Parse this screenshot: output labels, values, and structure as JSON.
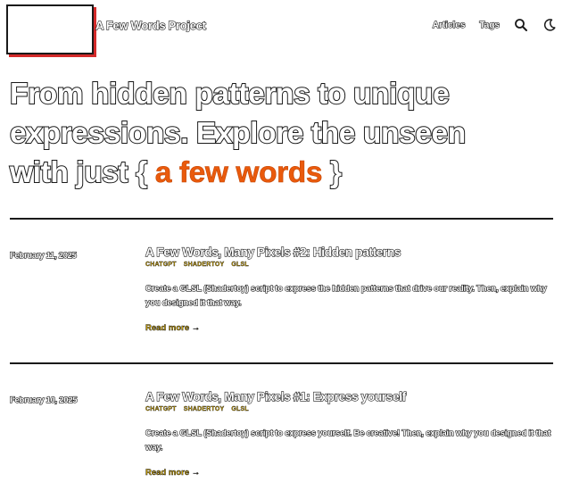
{
  "header": {
    "site_title": "A Few Words Project",
    "nav": {
      "articles": "Articles",
      "tags": "Tags"
    },
    "icons": {
      "search": "search-icon",
      "theme": "moon-icon"
    }
  },
  "hero": {
    "line1": "From hidden patterns to unique",
    "line2": "expressions. Explore the unseen",
    "line3_prefix": "with just",
    "brace_open": "{",
    "accent": "a few words",
    "brace_close": "}"
  },
  "colors": {
    "accent": "#ea5a0c",
    "tag": "#e9b800",
    "logo_shadow": "#d42a2a"
  },
  "posts": [
    {
      "date": "February 11, 2025",
      "title": "A Few Words, Many Pixels #2: Hidden patterns",
      "tags": [
        "CHATGPT",
        "SHADERTOY",
        "GLSL"
      ],
      "excerpt": "Create a GLSL (Shadertoy) script to express the hidden patterns that drive our reality. Then, explain why you designed it that way.",
      "read_more": "Read more →"
    },
    {
      "date": "February 10, 2025",
      "title": "A Few Words, Many Pixels #1: Express yourself",
      "tags": [
        "CHATGPT",
        "SHADERTOY",
        "GLSL"
      ],
      "excerpt": "Create a GLSL (Shadertoy) script to express yourself. Be creative! Then, explain why you designed it that way.",
      "read_more": "Read more →"
    }
  ]
}
